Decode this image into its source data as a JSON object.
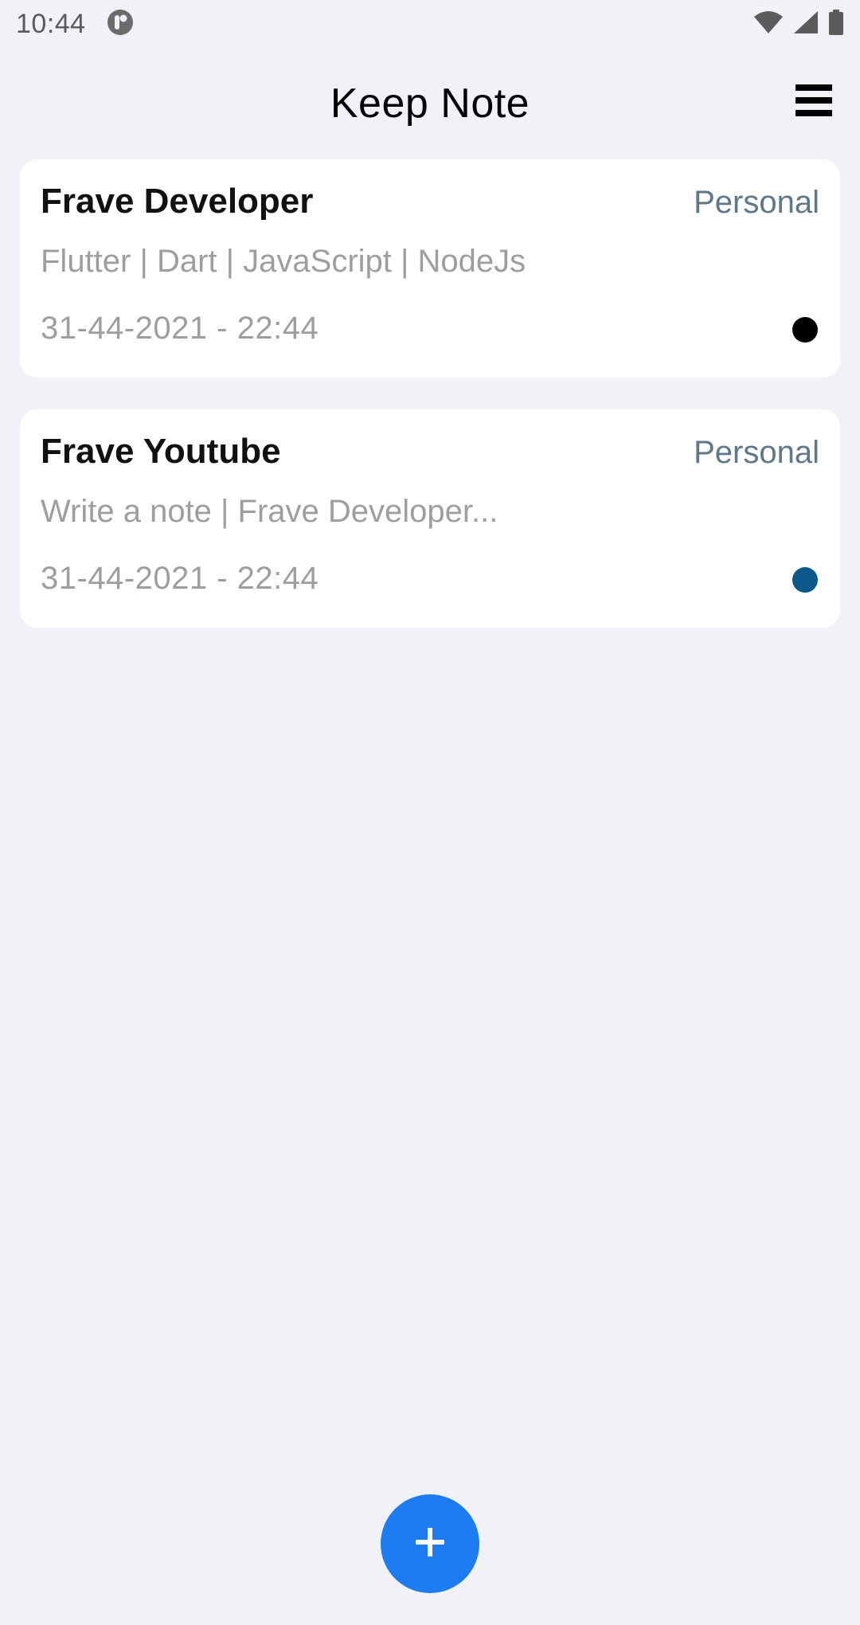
{
  "status_bar": {
    "time": "10:44",
    "icons": [
      "notification-app-icon",
      "wifi-icon",
      "signal-icon",
      "battery-icon"
    ]
  },
  "app_bar": {
    "title": "Keep Note",
    "menu_icon": "menu-icon"
  },
  "notes": [
    {
      "title": "Frave Developer",
      "category": "Personal",
      "body": "Flutter | Dart | JavaScript | NodeJs",
      "date": "31-44-2021 - 22:44",
      "color": "#000000"
    },
    {
      "title": "Frave Youtube",
      "category": "Personal",
      "body": "Write a note | Frave Developer...",
      "date": "31-44-2021 - 22:44",
      "color": "#0B5889"
    }
  ],
  "fab": {
    "icon": "plus-icon",
    "color": "#1E7CF2"
  }
}
